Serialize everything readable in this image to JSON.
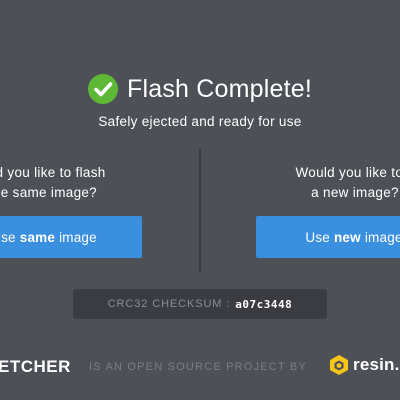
{
  "header": {
    "title": "Flash Complete!",
    "subtitle": "Safely ejected and ready for use",
    "status_icon": "check-circle-icon",
    "status_color": "#5fb835"
  },
  "panels": {
    "left": {
      "question_line1": "uld you like to flash",
      "question_line2": "he same image?",
      "button_prefix": "Use",
      "button_bold": "same",
      "button_suffix": "image"
    },
    "right": {
      "question_line1": "Would you like to fl",
      "question_line2": "a new image?",
      "button_prefix": "Use",
      "button_bold": "new",
      "button_suffix": "image"
    }
  },
  "checksum": {
    "label": "CRC32 CHECKSUM :",
    "value": "a07c3448"
  },
  "footer": {
    "brand": "ETCHER",
    "tagline": "IS AN OPEN SOURCE PROJECT BY",
    "company": "resin.i",
    "company_icon": "resin-cube-icon"
  },
  "colors": {
    "background": "#4d5057",
    "button": "#3b8fdf",
    "accent_yellow": "#f5c518"
  }
}
